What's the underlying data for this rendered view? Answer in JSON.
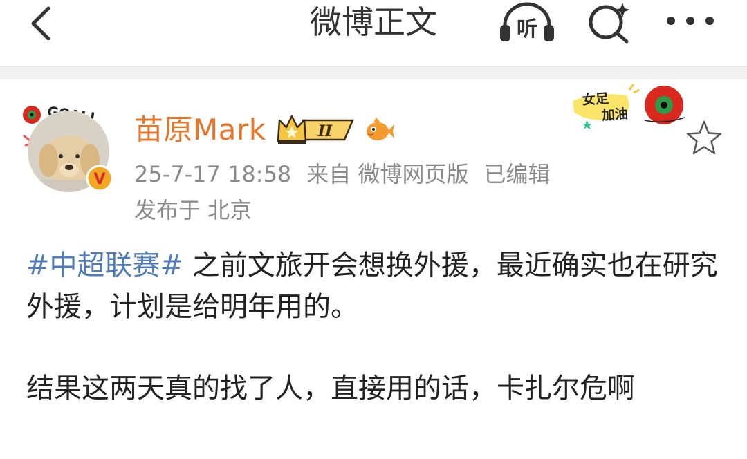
{
  "nav": {
    "title": "微博正文",
    "listen_label": "听"
  },
  "post": {
    "author": "苗原Mark",
    "level_badge": "II",
    "time": "25-7-17 18:58",
    "source": "来自 微博网页版",
    "edited": "已编辑",
    "location": "发布于 北京",
    "avatar_text": "GOAL!",
    "verify_mark": "V",
    "sticker_line1": "女足",
    "sticker_line2": "加油",
    "topic": "#中超联赛#",
    "para1_rest": " 之前文旅开会想换外援，最近确实也在研究外援，计划是给明年用的。",
    "para2": "结果这两天真的找了人，直接用的话，卡扎尔危啊"
  },
  "icons": [
    "back-arrow-icon",
    "headphones-icon",
    "search-spark-icon",
    "more-dots-icon",
    "star-outline-icon",
    "crown-icon",
    "fish-icon",
    "verified-v-icon"
  ],
  "colors": {
    "author_name": "#e8762a",
    "topic_link": "#4f7bb8",
    "meta_gray": "#8a8a8a",
    "verify_orange": "#f5a623",
    "separator": "#f2f2f2"
  }
}
